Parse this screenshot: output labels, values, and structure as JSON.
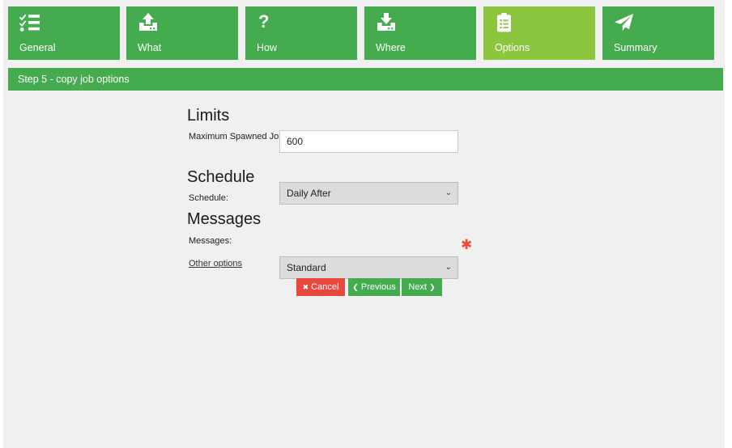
{
  "wizard": {
    "tabs": [
      {
        "label": "General",
        "icon": "list-check-icon",
        "active": false
      },
      {
        "label": "What",
        "icon": "upload-icon",
        "active": false
      },
      {
        "label": "How",
        "icon": "question-icon",
        "active": false
      },
      {
        "label": "Where",
        "icon": "download-icon",
        "active": false
      },
      {
        "label": "Options",
        "icon": "clipboard-list-icon",
        "active": true
      },
      {
        "label": "Summary",
        "icon": "paper-plane-icon",
        "active": false
      }
    ],
    "step_banner": "Step 5 - copy job options"
  },
  "sections": {
    "limits": {
      "heading": "Limits",
      "max_spawned_jobs_label": "Maximum Spawned Jobs:",
      "max_spawned_jobs_value": "600"
    },
    "schedule": {
      "heading": "Schedule",
      "schedule_label": "Schedule:",
      "schedule_value": "Daily After"
    },
    "messages": {
      "heading": "Messages",
      "messages_label": "Messages:",
      "messages_value": "Standard",
      "required_marker": "✱"
    },
    "other_options_link": "Other options"
  },
  "actions": {
    "cancel": "Cancel",
    "previous": "Previous",
    "next": "Next",
    "cancel_glyph": "✖",
    "previous_glyph": "❮",
    "next_glyph": "❯"
  },
  "colors": {
    "brand_green": "#45ab4f",
    "active_tab_green": "#8cc63f",
    "danger_red": "#e8483e",
    "required_red": "#f0483e",
    "page_background": "#f0f0f0"
  },
  "icons": {
    "chevron_down": "⌄"
  }
}
